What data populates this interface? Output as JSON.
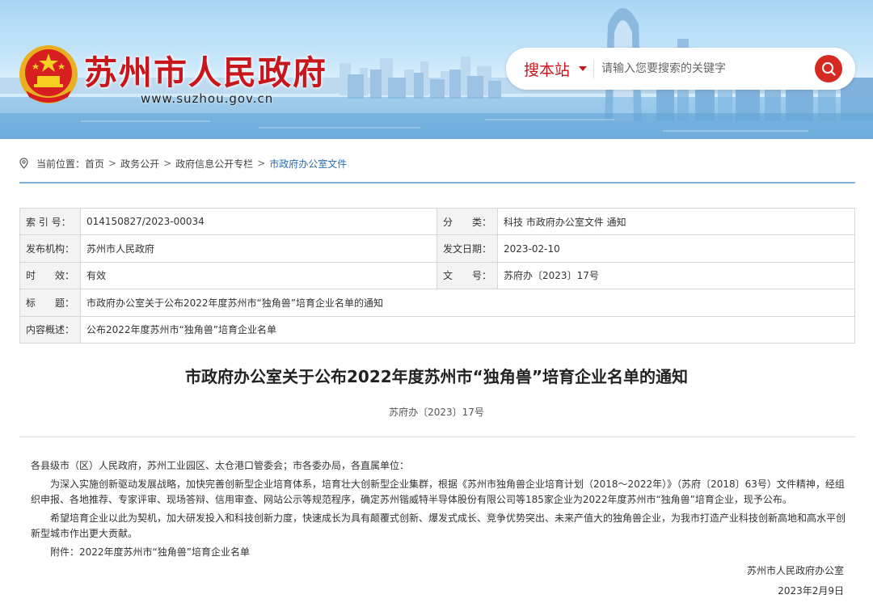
{
  "header": {
    "site_title": "苏州市人民政府",
    "site_url": "www.suzhou.gov.cn",
    "search": {
      "scope_label": "搜本站",
      "placeholder": "请输入您要搜索的关键字",
      "button_icon": "search-icon"
    },
    "colors": {
      "brand_red": "#c8161d",
      "search_red": "#d42a22"
    }
  },
  "breadcrumb": {
    "prefix": "当前位置：",
    "items": [
      "首页",
      "政务公开",
      "政府信息公开专栏",
      "市政府办公室文件"
    ],
    "separator": ">"
  },
  "info_table": {
    "index_label": "索 引 号：",
    "index_value": "014150827/2023-00034",
    "category_label": "分　　类：",
    "category_value": "科技 市政府办公室文件 通知",
    "publisher_label": "发布机构：",
    "publisher_value": "苏州市人民政府",
    "date_label": "发文日期：",
    "date_value": "2023-02-10",
    "validity_label": "时　　效：",
    "validity_value": "有效",
    "docno_label": "文　　号：",
    "docno_value": "苏府办〔2023〕17号",
    "title_label": "标　　题：",
    "title_value": "市政府办公室关于公布2022年度苏州市“独角兽”培育企业名单的通知",
    "summary_label": "内容概述：",
    "summary_value": "公布2022年度苏州市“独角兽”培育企业名单"
  },
  "article": {
    "title": "市政府办公室关于公布2022年度苏州市“独角兽”培育企业名单的通知",
    "doc_number": "苏府办〔2023〕17号",
    "salutation": "各县级市（区）人民政府，苏州工业园区、太仓港口管委会；市各委办局，各直属单位：",
    "para1": "为深入实施创新驱动发展战略，加快完善创新型企业培育体系，培育壮大创新型企业集群，根据《苏州市独角兽企业培育计划（2018～2022年）》（苏府〔2018〕63号）文件精神，经组织申报、各地推荐、专家评审、现场答辩、信用审查、网站公示等规范程序，确定苏州锴威特半导体股份有限公司等185家企业为2022年度苏州市“独角兽”培育企业，现予公布。",
    "para2": "希望培育企业以此为契机，加大研发投入和科技创新力度，快速成长为具有颠覆式创新、爆发式成长、竞争优势突出、未来产值大的独角兽企业，为我市打造产业科技创新高地和高水平创新型城市作出更大贡献。",
    "attachment": "附件：2022年度苏州市“独角兽”培育企业名单",
    "signature_org": "苏州市人民政府办公室",
    "signature_date": "2023年2月9日"
  }
}
